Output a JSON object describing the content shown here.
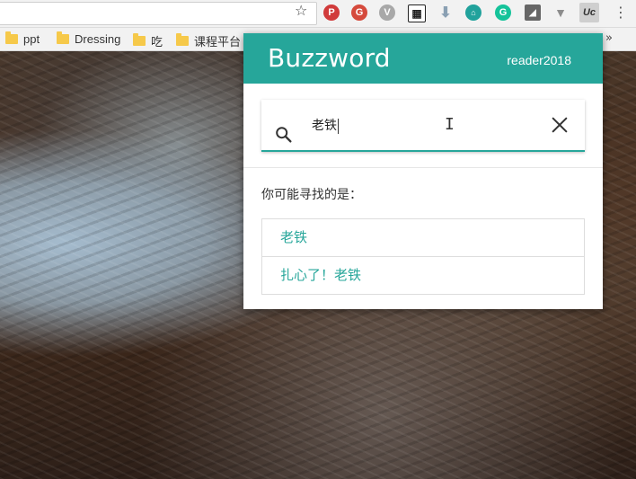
{
  "browser": {
    "extensions": [
      {
        "name": "pinterest-icon",
        "glyph": "P",
        "color": "#d13b3b"
      },
      {
        "name": "proxy-icon",
        "glyph": "G",
        "color": "#e04b3a"
      },
      {
        "name": "vysor-icon",
        "glyph": "V",
        "color": "#9e9e9e"
      },
      {
        "name": "qr-code-icon",
        "glyph": "▦",
        "color": "#222222"
      },
      {
        "name": "download-icon",
        "glyph": "⬇",
        "color": "#7a8fa3"
      },
      {
        "name": "bank-icon",
        "glyph": "🏛",
        "color": "#22a0a0"
      },
      {
        "name": "grammarly-icon",
        "glyph": "G",
        "color": "#15c39a"
      },
      {
        "name": "cast-icon",
        "glyph": "◢",
        "color": "#555555"
      },
      {
        "name": "vpn-icon",
        "glyph": "▼",
        "color": "#8c8c8c"
      },
      {
        "name": "buzzword-icon",
        "glyph": "Uc",
        "color": "#cccccc"
      }
    ]
  },
  "bookmarks": [
    {
      "label": "ppt"
    },
    {
      "label": "Dressing"
    },
    {
      "label": "吃"
    },
    {
      "label": "课程平台"
    }
  ],
  "popup": {
    "brand": "Buzzword",
    "user": "reader2018",
    "search": {
      "value": "老铁"
    },
    "hint": "你可能寻找的是：",
    "results": [
      "老铁",
      "扎心了！老铁"
    ],
    "accent_color": "#26a69a"
  }
}
